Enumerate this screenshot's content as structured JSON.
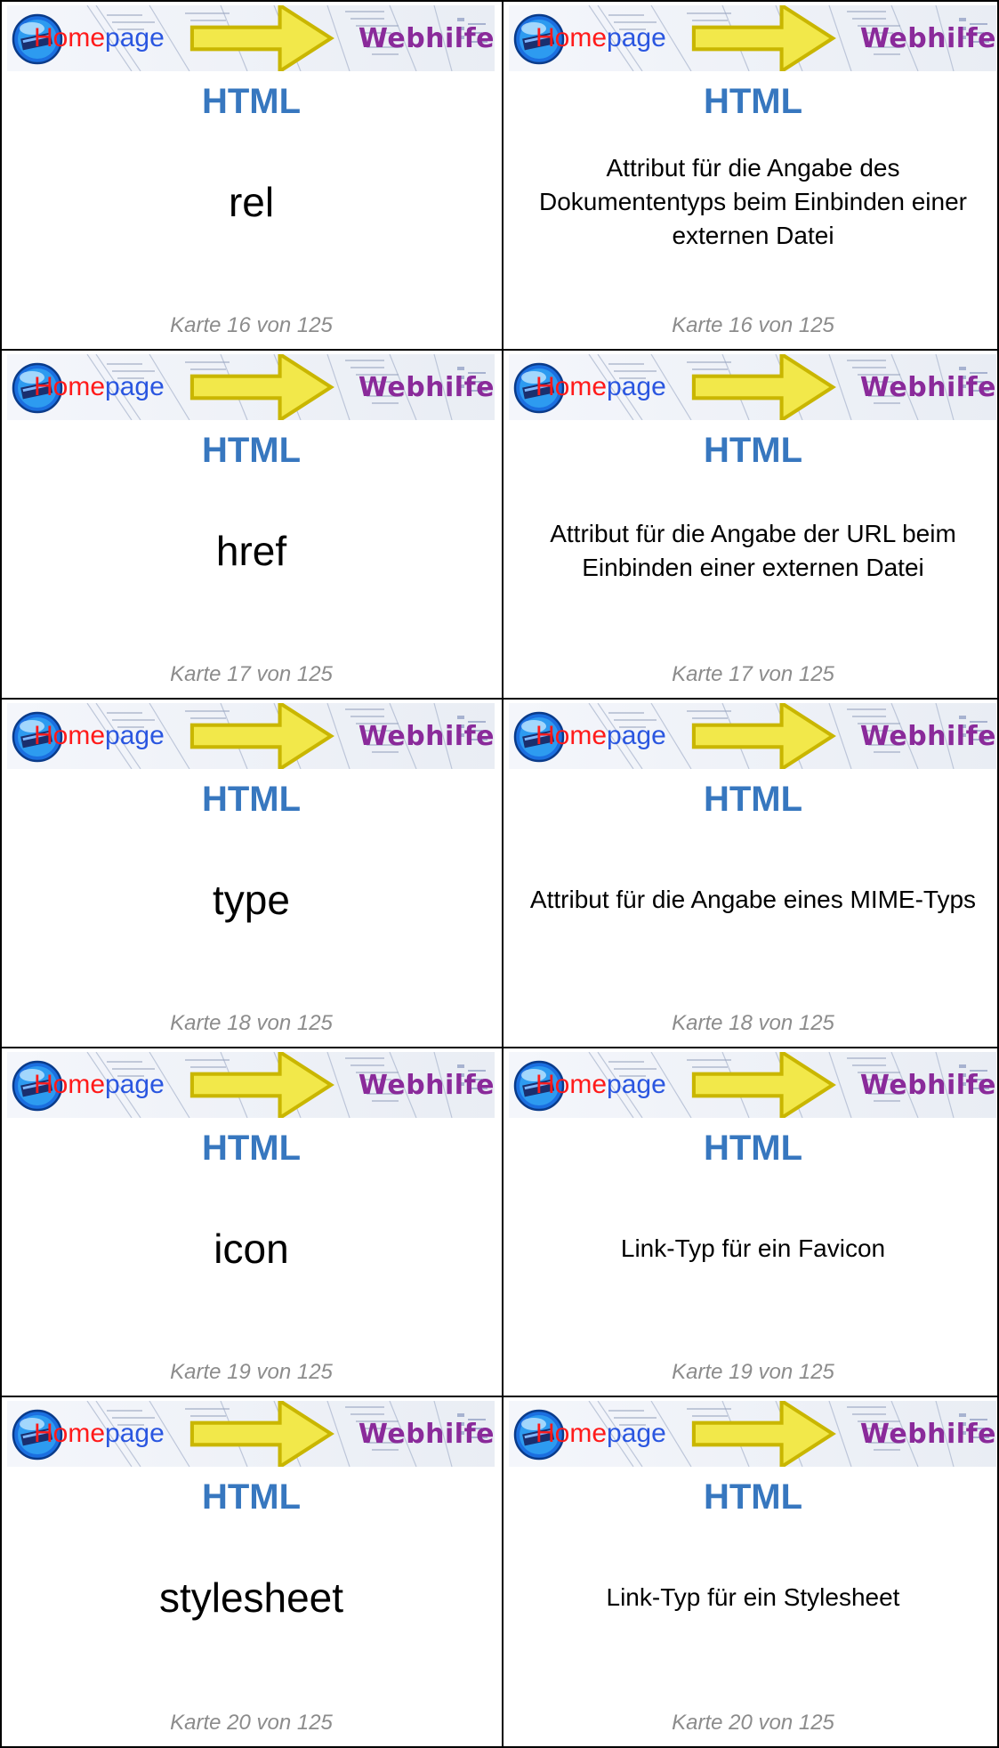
{
  "banner": {
    "home": "Home",
    "page": "page",
    "webhilfe": "Webhilfe",
    "logo_icon": "homepage-globe-logo-icon"
  },
  "cards": [
    {
      "heading": "HTML",
      "term": "rel",
      "definition": "Attribut für die Angabe des Dokumententyps beim Einbinden einer externen Datei",
      "footer": "Karte 16 von 125"
    },
    {
      "heading": "HTML",
      "term": "href",
      "definition": "Attribut für die Angabe der URL beim Einbinden einer externen Datei",
      "footer": "Karte 17 von 125"
    },
    {
      "heading": "HTML",
      "term": "type",
      "definition": "Attribut für die Angabe eines MIME-Typs",
      "footer": "Karte 18 von 125"
    },
    {
      "heading": "HTML",
      "term": "icon",
      "definition": "Link-Typ für ein Favicon",
      "footer": "Karte 19 von 125"
    },
    {
      "heading": "HTML",
      "term": "stylesheet",
      "definition": "Link-Typ für ein Stylesheet",
      "footer": "Karte 20 von 125"
    }
  ]
}
